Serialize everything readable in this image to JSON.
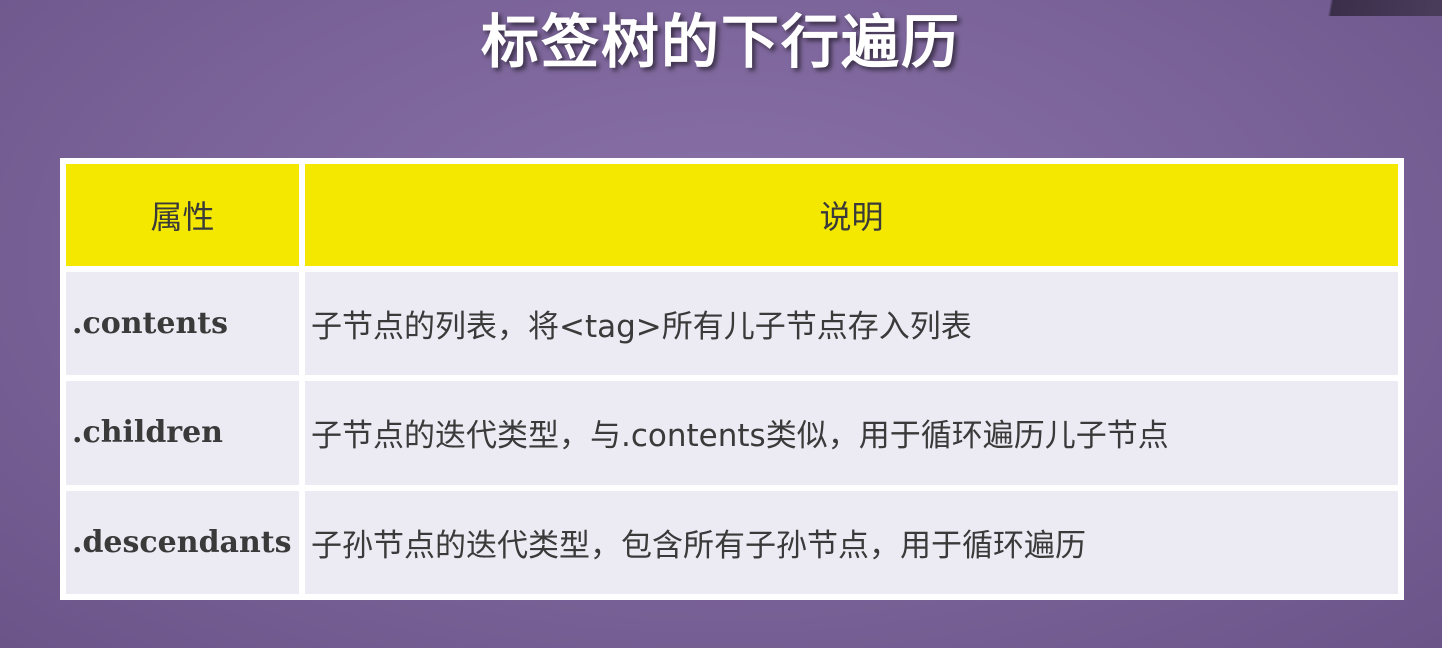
{
  "slide": {
    "title": "标签树的下行遍历"
  },
  "table": {
    "headers": [
      "属性",
      "说明"
    ],
    "rows": [
      {
        "attr": ".contents",
        "desc": "子节点的列表，将<tag>所有儿子节点存入列表"
      },
      {
        "attr": ".children",
        "desc": "子节点的迭代类型，与.contents类似，用于循环遍历儿子节点"
      },
      {
        "attr": ".descendants",
        "desc": "子孙节点的迭代类型，包含所有子孙节点，用于循环遍历"
      }
    ]
  },
  "colors": {
    "background": "#7a6398",
    "header_bg": "#f4e800",
    "cell_bg": "#ecebf4",
    "text": "#3a3a3a",
    "title": "#ffffff"
  }
}
